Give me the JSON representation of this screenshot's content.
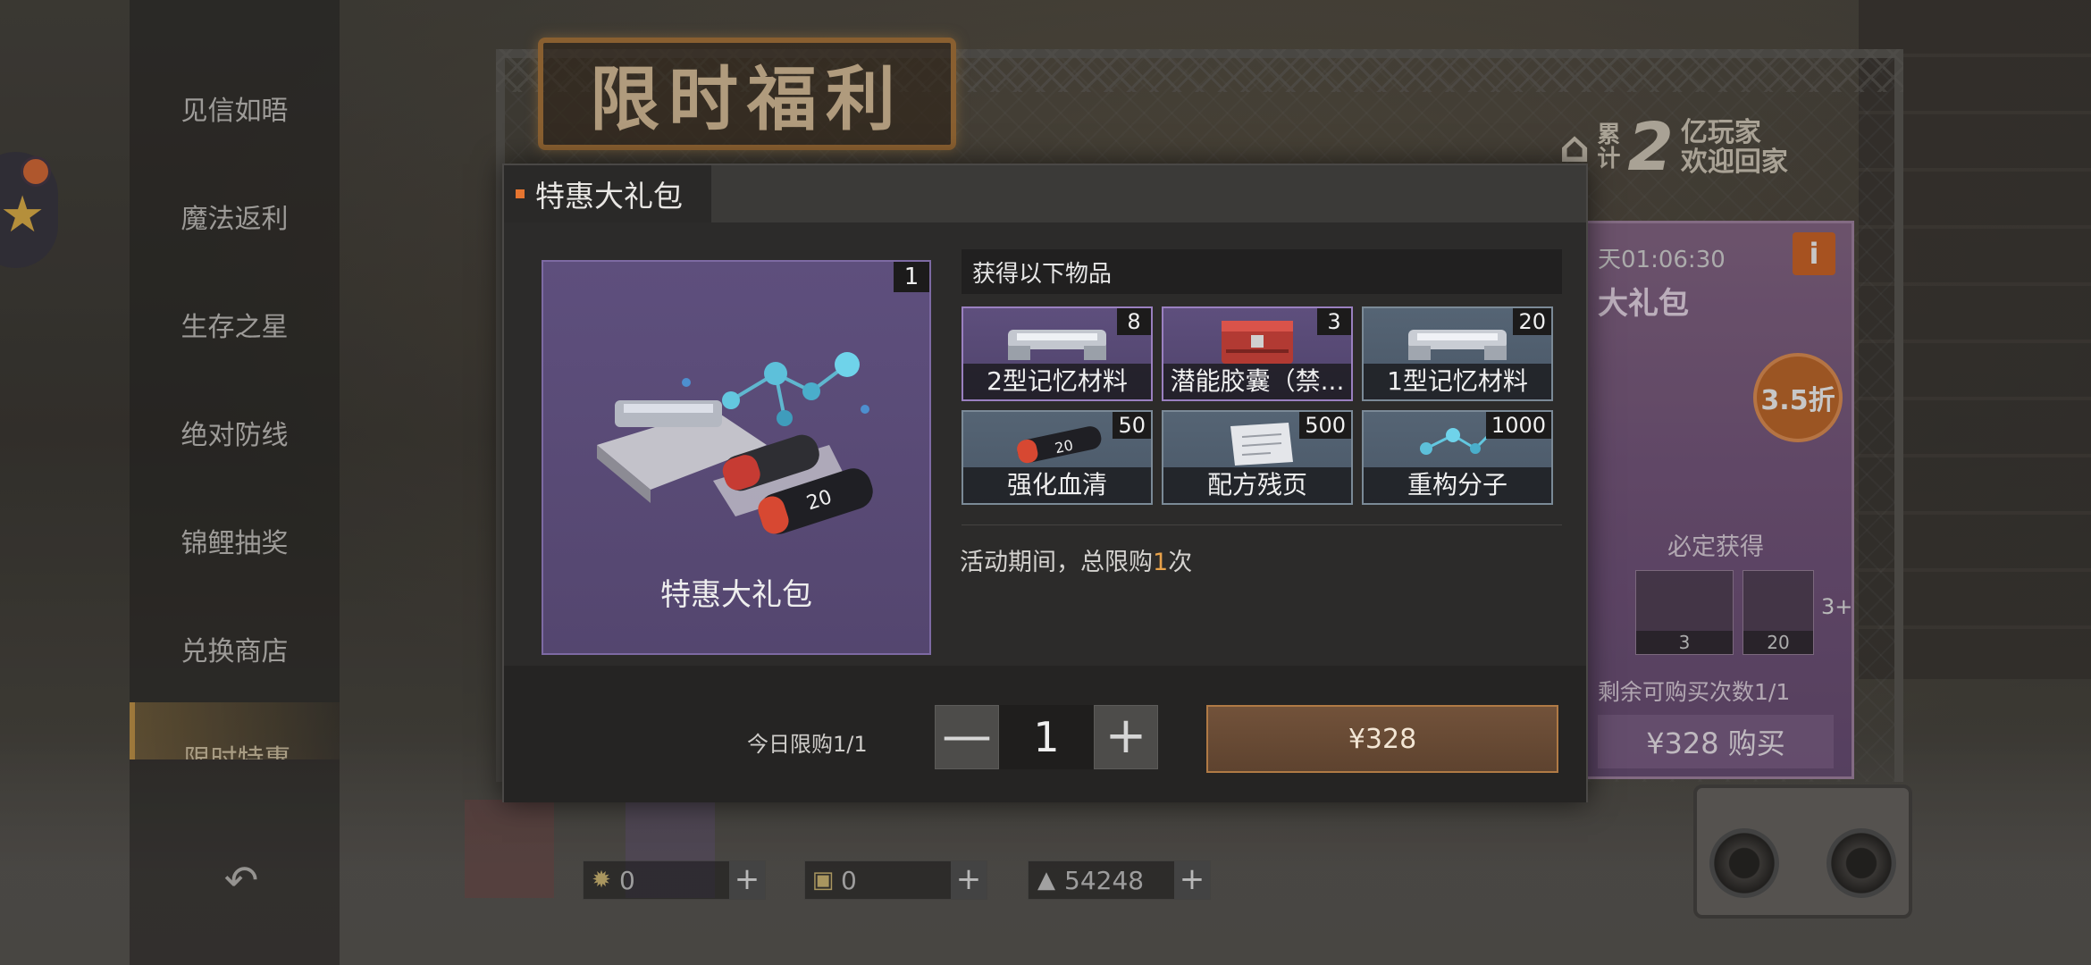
{
  "background": {
    "event_sign": "限时福利",
    "players_badge": {
      "line1": "累",
      "line2": "计",
      "number": "2",
      "text1": "亿玩家",
      "text2": "欢迎回家"
    }
  },
  "nav": {
    "items": [
      {
        "label": "见信如晤"
      },
      {
        "label": "魔法返利"
      },
      {
        "label": "生存之星"
      },
      {
        "label": "绝对防线"
      },
      {
        "label": "锦鲤抽奖"
      },
      {
        "label": "兑换商店"
      },
      {
        "label": "限时特惠",
        "active": true
      }
    ]
  },
  "promo_card": {
    "timer": "天01:06:30",
    "title": "大礼包",
    "discount": "3.5折",
    "guarantee_label": "必定获得",
    "mini_items": [
      {
        "count": "3"
      },
      {
        "count": "20"
      }
    ],
    "more": "3+",
    "remaining": "剩余可购买次数1/1",
    "buy_label": "¥328 购买"
  },
  "currencies": [
    {
      "icon": "gear-coin-icon",
      "value": "0"
    },
    {
      "icon": "ticket-icon",
      "value": "0"
    },
    {
      "icon": "crystal-icon",
      "value": "54248"
    }
  ],
  "dialog": {
    "title": "特惠大礼包",
    "pack": {
      "name": "特惠大礼包",
      "count": "1"
    },
    "items_header": "获得以下物品",
    "items": [
      {
        "name": "2型记忆材料",
        "qty": "8",
        "rarity": "purple"
      },
      {
        "name": "潜能胶囊（禁...",
        "qty": "3",
        "rarity": "purple"
      },
      {
        "name": "1型记忆材料",
        "qty": "20",
        "rarity": "blue"
      },
      {
        "name": "强化血清",
        "qty": "50",
        "rarity": "blue"
      },
      {
        "name": "配方残页",
        "qty": "500",
        "rarity": "blue"
      },
      {
        "name": "重构分子",
        "qty": "1000",
        "rarity": "blue"
      }
    ],
    "limit_prefix": "活动期间，总限购",
    "limit_value": "1",
    "limit_suffix": "次",
    "daily_limit": "今日限购1/1",
    "quantity": "1",
    "minus_label": "—",
    "plus_label": "+",
    "price_label": "¥328"
  },
  "colors": {
    "accent": "#e67530",
    "price_button": "#6a4b35",
    "purple_rarity": "#5e4f7d",
    "blue_rarity": "#4f5e6e"
  }
}
